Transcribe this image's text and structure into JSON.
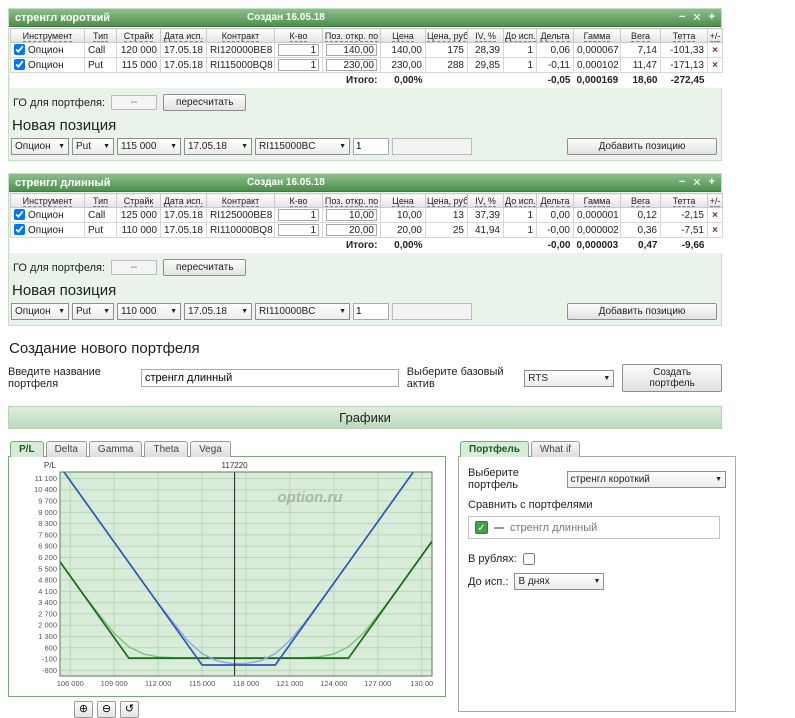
{
  "icons": {
    "chevron_down": "▼",
    "close": "✕",
    "minimize": "−",
    "add": "+",
    "check": "✓",
    "zoom_in": "⊕",
    "zoom_out": "⊖",
    "reset": "↺",
    "delete": "×"
  },
  "colors": {
    "accent": "#4e8f4e",
    "panel_bg": "#e9f3e9",
    "chart_bg": "#d9ecd9"
  },
  "table_headers": [
    "Инструмент",
    "Тип",
    "Страйк",
    "Дата исп.",
    "Контракт",
    "К-во",
    "Поз. откр. по",
    "Цена",
    "Цена, руб.",
    "IV, %",
    "До исп.",
    "Дельта",
    "Гамма",
    "Вега",
    "Тетта",
    "+/-"
  ],
  "panels": [
    {
      "title": "стренгл короткий",
      "created": "Создан 16.05.18",
      "table": {
        "rows": [
          {
            "instrument": "Опцион",
            "type": "Call",
            "strike": "120 000",
            "exp_date": "17.05.18",
            "contract": "RI120000BE8",
            "qty": "1",
            "open_price": "140,00",
            "price": "140,00",
            "price_rub": "175",
            "iv": "28,39",
            "days": "1",
            "delta": "0,06",
            "gamma": "0,000067",
            "vega": "7,14",
            "theta": "-101,33"
          },
          {
            "instrument": "Опцион",
            "type": "Put",
            "strike": "115 000",
            "exp_date": "17.05.18",
            "contract": "RI115000BQ8",
            "qty": "1",
            "open_price": "230,00",
            "price": "230,00",
            "price_rub": "288",
            "iv": "29,85",
            "days": "1",
            "delta": "-0,11",
            "gamma": "0,000102",
            "vega": "11,47",
            "theta": "-171,13"
          }
        ],
        "totals": {
          "label": "Итого:",
          "pct": "0,00%",
          "delta": "-0,05",
          "gamma": "0,000169",
          "vega": "18,60",
          "theta": "-272,45"
        }
      },
      "go_label": "ГО для портфеля:",
      "go_value": "--",
      "recalc_label": "пересчитать",
      "new_position_title": "Новая позиция",
      "new_position": {
        "kind": "Опцион",
        "type": "Put",
        "strike": "115 000",
        "date": "17.05.18",
        "contract": "RI115000BC",
        "qty": "1",
        "add_label": "Добавить позицию"
      }
    },
    {
      "title": "стренгл длинный",
      "created": "Создан 16.05.18",
      "table": {
        "rows": [
          {
            "instrument": "Опцион",
            "type": "Call",
            "strike": "125 000",
            "exp_date": "17.05.18",
            "contract": "RI125000BE8",
            "qty": "1",
            "open_price": "10,00",
            "price": "10,00",
            "price_rub": "13",
            "iv": "37,39",
            "days": "1",
            "delta": "0,00",
            "gamma": "0,000001",
            "vega": "0,12",
            "theta": "-2,15"
          },
          {
            "instrument": "Опцион",
            "type": "Put",
            "strike": "110 000",
            "exp_date": "17.05.18",
            "contract": "RI110000BQ8",
            "qty": "1",
            "open_price": "20,00",
            "price": "20,00",
            "price_rub": "25",
            "iv": "41,94",
            "days": "1",
            "delta": "-0,00",
            "gamma": "0,000002",
            "vega": "0,36",
            "theta": "-7,51"
          }
        ],
        "totals": {
          "label": "Итого:",
          "pct": "0,00%",
          "delta": "-0,00",
          "gamma": "0,000003",
          "vega": "0,47",
          "theta": "-9,66"
        }
      },
      "go_label": "ГО для портфеля:",
      "go_value": "--",
      "recalc_label": "пересчитать",
      "new_position_title": "Новая позиция",
      "new_position": {
        "kind": "Опцион",
        "type": "Put",
        "strike": "110 000",
        "date": "17.05.18",
        "contract": "RI110000BC",
        "qty": "1",
        "add_label": "Добавить позицию"
      }
    }
  ],
  "create_portfolio": {
    "title": "Создание нового портфеля",
    "name_label": "Введите название портфеля",
    "name_value": "стренгл длинный",
    "asset_label": "Выберите базовый актив",
    "asset_value": "RTS",
    "button": "Создать портфель"
  },
  "charts_title": "Графики",
  "chart_tabs": [
    "P/L",
    "Delta",
    "Gamma",
    "Theta",
    "Vega"
  ],
  "right_panel": {
    "tabs": [
      "Портфель",
      "What if"
    ],
    "select_portfolio_label": "Выберите портфель",
    "selected_portfolio": "стренгл короткий",
    "compare_label": "Сравнить с портфелями",
    "compare_item": "стренгл длинный",
    "rub_label": "В рублях:",
    "days_label": "До исп.:",
    "days_value": "В днях"
  },
  "chart_data": {
    "type": "line",
    "ylabel": "P/L",
    "watermark": "option.ru",
    "price_marker": {
      "x": 117220,
      "label": "117220"
    },
    "xlim": [
      105300,
      130700
    ],
    "ylim": [
      -1150,
      11500
    ],
    "y_ticks": [
      11100,
      10400,
      9700,
      9000,
      8300,
      7600,
      6900,
      6200,
      5500,
      4800,
      4100,
      3400,
      2700,
      2000,
      1300,
      600,
      -100,
      -800
    ],
    "x_ticks": [
      106000,
      109000,
      112000,
      115000,
      118000,
      121000,
      124000,
      127000,
      130000
    ],
    "x_tick_labels": [
      "106 000",
      "109 000",
      "112 000",
      "115 000",
      "118 000",
      "121 000",
      "124 000",
      "127 000",
      "130 00"
    ],
    "grid": true,
    "series": [
      {
        "name": "strangle-wide-current",
        "color": "#7cc47c",
        "width": 1.4,
        "points": [
          [
            105600,
            5554
          ],
          [
            107000,
            3796
          ],
          [
            109000,
            1488
          ],
          [
            110000,
            665
          ],
          [
            111000,
            216
          ],
          [
            112000,
            42
          ],
          [
            113000,
            -14
          ],
          [
            115000,
            -36
          ],
          [
            117500,
            -48
          ],
          [
            120000,
            -36
          ],
          [
            122000,
            -14
          ],
          [
            123000,
            42
          ],
          [
            124000,
            216
          ],
          [
            125000,
            665
          ],
          [
            126000,
            1488
          ],
          [
            127500,
            3180
          ],
          [
            129000,
            5049
          ],
          [
            130700,
            7200
          ]
        ]
      },
      {
        "name": "strangle-wide-expiry",
        "color": "#1a6b1a",
        "width": 1.7,
        "points": [
          [
            105300,
            5930
          ],
          [
            110000,
            -38
          ],
          [
            125000,
            -38
          ],
          [
            130700,
            7200
          ]
        ]
      },
      {
        "name": "strangle-narrow-current",
        "color": "#85a8e0",
        "width": 1.4,
        "points": [
          [
            105600,
            11468
          ],
          [
            108000,
            8420
          ],
          [
            110000,
            5883
          ],
          [
            112000,
            3364
          ],
          [
            114000,
            1057
          ],
          [
            115000,
            236
          ],
          [
            116000,
            -209
          ],
          [
            117000,
            -366
          ],
          [
            117500,
            -383
          ],
          [
            118000,
            -366
          ],
          [
            119000,
            -209
          ],
          [
            120000,
            236
          ],
          [
            121000,
            1057
          ],
          [
            122000,
            2150
          ],
          [
            124000,
            4616
          ],
          [
            126000,
            7150
          ],
          [
            128000,
            9690
          ],
          [
            130700,
            13119
          ]
        ]
      },
      {
        "name": "strangle-narrow-expiry",
        "color": "#2f55c0",
        "width": 1.7,
        "points": [
          [
            105300,
            11850
          ],
          [
            115000,
            -470
          ],
          [
            120000,
            -470
          ],
          [
            130700,
            13119
          ]
        ]
      }
    ]
  }
}
